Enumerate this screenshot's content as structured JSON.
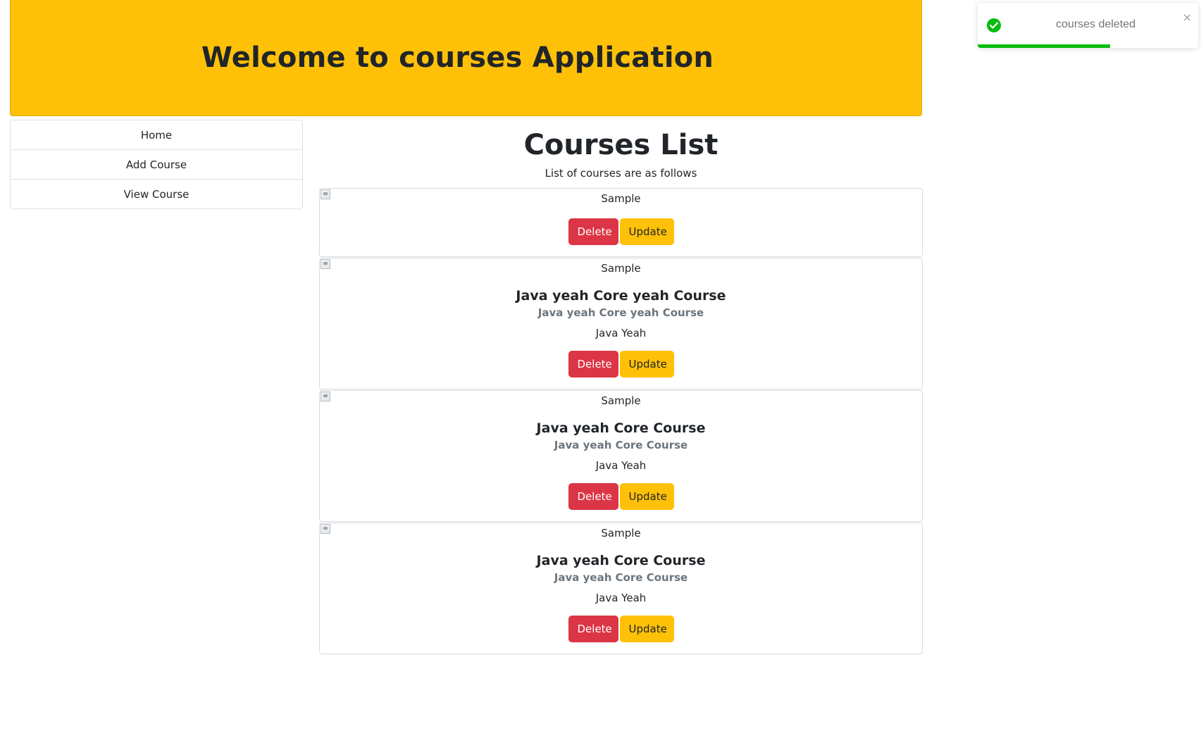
{
  "header": {
    "title": "Welcome to courses Application"
  },
  "sidebar": {
    "items": [
      {
        "label": "Home"
      },
      {
        "label": "Add Course"
      },
      {
        "label": "View Course"
      }
    ]
  },
  "main": {
    "title": "Courses List",
    "subtitle": "List of courses are as follows"
  },
  "courses": [
    {
      "image_alt": "Sample",
      "title": "",
      "subtitle": "",
      "description": "",
      "delete_label": "Delete",
      "update_label": "Update"
    },
    {
      "image_alt": "Sample",
      "title": "Java yeah Core yeah Course",
      "subtitle": "Java yeah Core yeah Course",
      "description": "Java Yeah",
      "delete_label": "Delete",
      "update_label": "Update"
    },
    {
      "image_alt": "Sample",
      "title": "Java yeah Core Course",
      "subtitle": "Java yeah Core Course",
      "description": "Java Yeah",
      "delete_label": "Delete",
      "update_label": "Update"
    },
    {
      "image_alt": "Sample",
      "title": "Java yeah Core Course",
      "subtitle": "Java yeah Core Course",
      "description": "Java Yeah",
      "delete_label": "Delete",
      "update_label": "Update"
    }
  ],
  "toast": {
    "message": "courses deleted",
    "status": "success",
    "icon": "check-circle-icon",
    "close_glyph": "×",
    "progress": 0.6
  },
  "colors": {
    "banner": "#ffc107",
    "danger": "#dc3545",
    "warning": "#ffc107",
    "success": "#07bc0c"
  }
}
